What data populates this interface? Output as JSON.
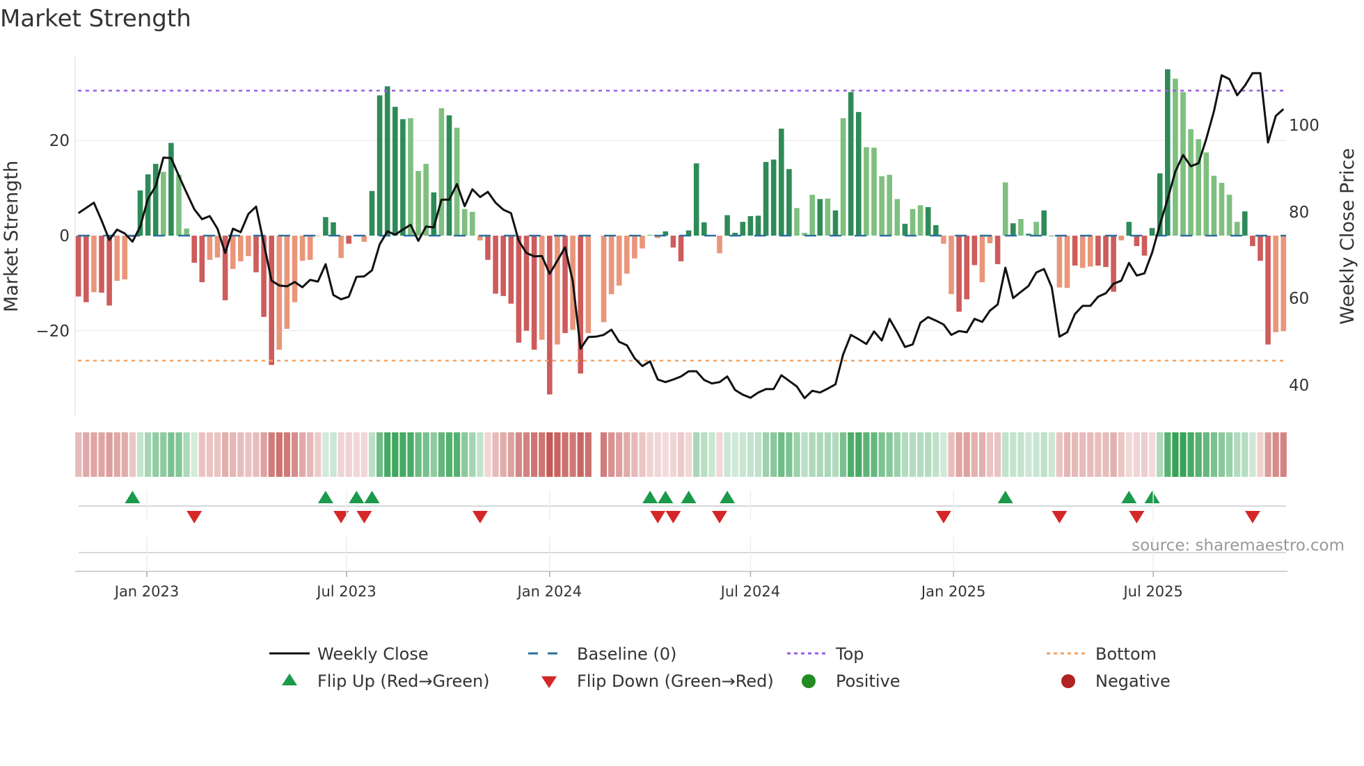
{
  "chart_data": {
    "type": "bar",
    "title": "Market Strength",
    "start_week": "2022-10-31",
    "frequency_days": 7,
    "left_axis": {
      "label": "Market Strength",
      "ticks": [
        "20",
        "0",
        "−20"
      ],
      "tick_values": [
        20,
        0,
        -20
      ]
    },
    "right_axis": {
      "label": "Weekly Close Price",
      "ticks": [
        "100",
        "80",
        "60",
        "40"
      ],
      "tick_values": [
        100,
        80,
        60,
        40
      ]
    },
    "x_ticks": [
      {
        "label": "Jan 2023",
        "date": "2023-01-01"
      },
      {
        "label": "Jul 2023",
        "date": "2023-07-01"
      },
      {
        "label": "Jan 2024",
        "date": "2024-01-01"
      },
      {
        "label": "Jul 2024",
        "date": "2024-07-01"
      },
      {
        "label": "Jan 2025",
        "date": "2025-01-01"
      },
      {
        "label": "Jul 2025",
        "date": "2025-07-01"
      }
    ],
    "ylim_strength": [
      -38,
      38.5
    ],
    "top_level": 30.5,
    "bottom_level": -26.3,
    "baseline": 0,
    "strength": [
      -12.8,
      -14.0,
      -11.9,
      -12.0,
      -14.7,
      -9.5,
      -9.2,
      -0.3,
      9.5,
      12.9,
      15.1,
      13.4,
      19.5,
      12.8,
      1.5,
      -5.7,
      -9.8,
      -5.1,
      -4.6,
      -13.6,
      -7.0,
      -5.4,
      -4.3,
      -7.7,
      -17.1,
      -27.2,
      -24.0,
      -19.6,
      -14.0,
      -5.3,
      -5.1,
      -0.1,
      3.9,
      2.8,
      -4.7,
      -1.7,
      -0.1,
      -1.3,
      9.4,
      29.5,
      31.4,
      27.1,
      24.5,
      24.7,
      13.6,
      15.1,
      9.1,
      26.8,
      25.3,
      22.7,
      5.6,
      5.0,
      -1.0,
      -5.1,
      -12.2,
      -12.7,
      -14.3,
      -22.5,
      -20.0,
      -24.0,
      -21.9,
      -33.4,
      -22.9,
      -20.5,
      -19.8,
      -29.0,
      -20.5,
      null,
      -18.2,
      -12.3,
      -10.5,
      -8.0,
      -4.8,
      -2.7,
      0.2,
      -0.5,
      0.9,
      -2.5,
      -5.4,
      1.1,
      15.2,
      2.8,
      0,
      -3.7,
      4.3,
      0.6,
      2.9,
      4.1,
      4.2,
      15.5,
      16.0,
      22.5,
      14.0,
      5.8,
      0.6,
      8.6,
      7.7,
      7.8,
      5.3,
      24.7,
      30.2,
      26.0,
      18.6,
      18.5,
      12.5,
      12.8,
      7.7,
      2.5,
      5.6,
      6.4,
      6.0,
      2.2,
      -1.7,
      -12.3,
      -16.0,
      -13.4,
      -6.2,
      -9.8,
      -1.6,
      -6.0,
      11.2,
      2.6,
      3.5,
      0.4,
      2.9,
      5.3,
      0,
      -10.9,
      -11.0,
      -6.3,
      -6.8,
      -6.5,
      -6.3,
      -6.6,
      -11.8,
      -1.0,
      2.9,
      -2.2,
      -4.2,
      1.6,
      13.1,
      35.0,
      33.0,
      30.2,
      22.4,
      20.3,
      17.5,
      12.6,
      11.1,
      8.6,
      2.9,
      5.1,
      -2.2,
      -5.3,
      -22.9,
      -20.3,
      -20.1
    ],
    "strength_shade": "ddlddllddddldlldd lldllldddllllllddldlldddddllldldlllldddddddldldldlllxllllllddddddlxdddddddddllldldlddllllldllddlldddlldldldxddlldlldddlddddddlllllllllddddll",
    "weekly_close": [
      79.7,
      80.9,
      82.1,
      78.0,
      73.5,
      75.9,
      75.0,
      73.1,
      76.6,
      83.0,
      85.9,
      92.5,
      92.4,
      88.3,
      84.4,
      80.6,
      78.3,
      79.0,
      76.1,
      70.5,
      76.1,
      75.3,
      79.5,
      81.2,
      72.7,
      64.1,
      63.0,
      62.8,
      63.8,
      62.6,
      64.3,
      63.9,
      67.9,
      60.8,
      59.8,
      60.4,
      65.0,
      65.1,
      66.5,
      72.5,
      75.5,
      74.7,
      75.9,
      77.0,
      73.3,
      76.6,
      76.4,
      82.8,
      82.8,
      86.4,
      81.3,
      85.2,
      83.4,
      84.6,
      82.1,
      80.5,
      79.7,
      73.3,
      70.5,
      69.7,
      69.8,
      65.7,
      68.7,
      71.8,
      63.9,
      48.4,
      51.1,
      51.2,
      51.6,
      52.8,
      50.0,
      49.2,
      46.2,
      44.4,
      45.5,
      41.3,
      40.7,
      41.3,
      42.0,
      43.2,
      43.2,
      41.2,
      40.4,
      40.7,
      42.0,
      38.9,
      37.8,
      37.1,
      38.3,
      39.1,
      39.1,
      42.3,
      41.0,
      39.7,
      37.0,
      38.7,
      38.3,
      39.2,
      40.2,
      47.1,
      51.6,
      50.6,
      49.5,
      52.4,
      50.3,
      55.3,
      52.2,
      48.8,
      49.4,
      54.4,
      55.7,
      54.9,
      54.0,
      51.6,
      52.5,
      52.2,
      55.3,
      54.6,
      57.2,
      58.6,
      67.1,
      60.1,
      61.5,
      62.9,
      66.0,
      66.8,
      62.6,
      51.2,
      52.2,
      56.4,
      58.3,
      58.3,
      60.4,
      61.2,
      63.4,
      64.1,
      68.2,
      65.3,
      65.8,
      70.6,
      77.0,
      82.9,
      89.3,
      93.1,
      90.5,
      91.2,
      96.8,
      103.2,
      111.5,
      110.6,
      106.9,
      109.1,
      112.0,
      112.0,
      96.0,
      102.1,
      103.7
    ],
    "price_ylim": [
      34,
      124
    ],
    "flip_up_weeks": [
      7,
      32,
      36,
      38,
      74,
      76,
      79,
      84,
      120,
      136,
      139
    ],
    "flip_down_weeks": [
      15,
      34,
      37,
      52,
      75,
      77,
      83,
      112,
      127,
      137,
      152
    ],
    "legend": [
      {
        "label": "Weekly Close",
        "symbol": "line"
      },
      {
        "label": "Baseline (0)",
        "symbol": "dash"
      },
      {
        "label": "Top",
        "symbol": "dot-purple"
      },
      {
        "label": "Bottom",
        "symbol": "dot-orange"
      },
      {
        "label": "Flip Up (Red→Green)",
        "symbol": "triangle-up"
      },
      {
        "label": "Flip Down (Green→Red)",
        "symbol": "triangle-down"
      },
      {
        "label": "Positive",
        "symbol": "circle-green"
      },
      {
        "label": "Negative",
        "symbol": "circle-red"
      }
    ],
    "source": "source: sharemaestro.com",
    "colors": {
      "pos_dark": "#2e8b57",
      "pos_light": "#7fbf7f",
      "neg_dark": "#cd5c5c",
      "neg_light": "#e9967a",
      "line": "#111111",
      "baseline": "#2a6f9e",
      "top": "#9b5de5",
      "bottom": "#f4a261",
      "flip_up": "#1a9a4a",
      "flip_down": "#d62728",
      "positive": "#228b22",
      "negative": "#b22222",
      "strip_pos": "#2e9e4f",
      "strip_neg": "#c0504d"
    }
  }
}
